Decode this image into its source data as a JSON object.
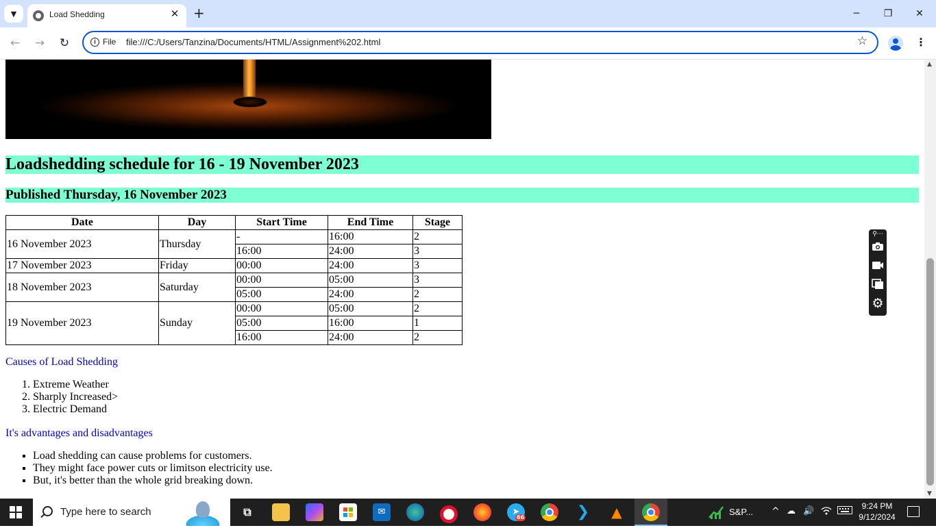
{
  "browser": {
    "tab_title": "Load Shedding",
    "tab_close_glyph": "✕",
    "new_tab_glyph": "+",
    "minimize_glyph": "─",
    "restore_glyph": "❐",
    "close_glyph": "✕",
    "back_glyph": "←",
    "forward_glyph": "→",
    "reload_glyph": "↻",
    "info_glyph": "i",
    "url_chip": "File",
    "url": "file:///C:/Users/Tanzina/Documents/HTML/Assignment%202.html",
    "star_glyph": "☆",
    "menu_glyph": "⋮",
    "tab_menu_glyph": "▼"
  },
  "page": {
    "heading": "Loadshedding schedule for 16 - 19 November 2023",
    "subheading": "Published Thursday, 16 November 2023",
    "table": {
      "headers": [
        "Date",
        "Day",
        "Start Time",
        "End Time",
        "Stage"
      ],
      "groups": [
        {
          "date": "16 November 2023",
          "day": "Thursday",
          "slots": [
            [
              "-",
              "16:00",
              "2"
            ],
            [
              "16:00",
              "24:00",
              "3"
            ]
          ]
        },
        {
          "date": "17 November 2023",
          "day": "Friday",
          "slots": [
            [
              "00:00",
              "24:00",
              "3"
            ]
          ]
        },
        {
          "date": "18 November 2023",
          "day": "Saturday",
          "slots": [
            [
              "00:00",
              "05:00",
              "3"
            ],
            [
              "05:00",
              "24:00",
              "2"
            ]
          ]
        },
        {
          "date": "19 November 2023",
          "day": "Sunday",
          "slots": [
            [
              "00:00",
              "05:00",
              "2"
            ],
            [
              "05:00",
              "16:00",
              "1"
            ],
            [
              "16:00",
              "24:00",
              "2"
            ]
          ]
        }
      ]
    },
    "causes": {
      "title": "Causes of Load Shedding",
      "items": [
        "Extreme Weather",
        "Sharply Increased>",
        "Electric Demand"
      ]
    },
    "advantages": {
      "title": "It's advantages and disadvantages",
      "items": [
        "Load shedding can cause problems for customers.",
        "They might face power cuts or limitson electricity use.",
        "But, it's better than the whole grid breaking down."
      ]
    }
  },
  "floating_toolbar": {
    "items": [
      "camera-icon",
      "video-icon",
      "copy-icon",
      "settings-icon"
    ]
  },
  "taskbar": {
    "search_placeholder": "Type here to search",
    "telegram_badge": "66",
    "stock_label": "S&P...",
    "time": "9:24 PM",
    "date": "9/12/2024",
    "tray_up_glyph": "^",
    "volume_glyph": "🔊"
  },
  "colors": {
    "heading_bg": "#7fffd4",
    "link_blue": "#0000cd",
    "taskbar_bg": "#1f1f1f",
    "chrome_tabbar": "#d3e3fd",
    "omnibox_border": "#0b57d0"
  }
}
